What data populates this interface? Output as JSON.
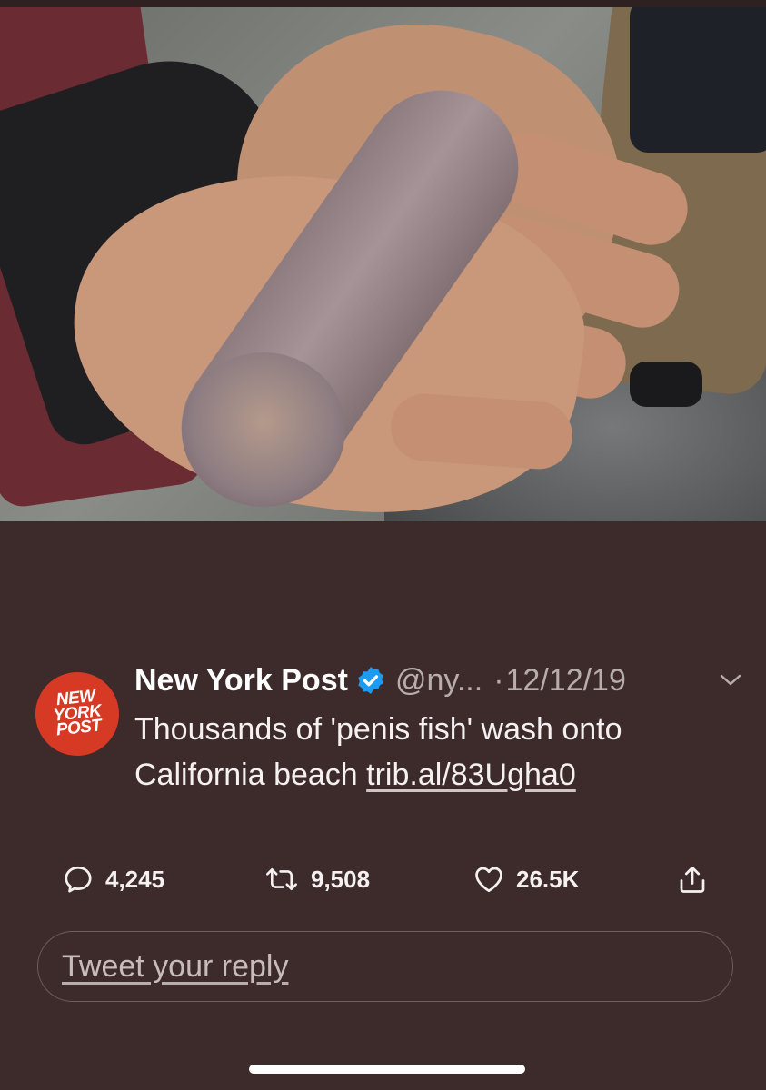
{
  "tweet": {
    "author_name": "New York Post",
    "avatar_text": [
      "NEW",
      "YORK",
      "POST"
    ],
    "handle": "@ny...",
    "separator": "·",
    "date": "12/12/19",
    "text": "Thousands of 'penis fish' wash onto California beach",
    "link": "trib.al/83Ugha0"
  },
  "actions": {
    "replies": "4,245",
    "retweets": "9,508",
    "likes": "26.5K"
  },
  "reply_box": {
    "placeholder": "Tweet your reply"
  },
  "icons": {
    "reply": "comment-icon",
    "retweet": "retweet-icon",
    "like": "heart-icon",
    "share": "share-icon",
    "verified": "verified-badge-icon",
    "more": "chevron-down-icon"
  },
  "colors": {
    "background": "#3d2b2b",
    "avatar": "#d63a24",
    "verified": "#1d9bf0",
    "secondary_text": "#b7adab"
  }
}
